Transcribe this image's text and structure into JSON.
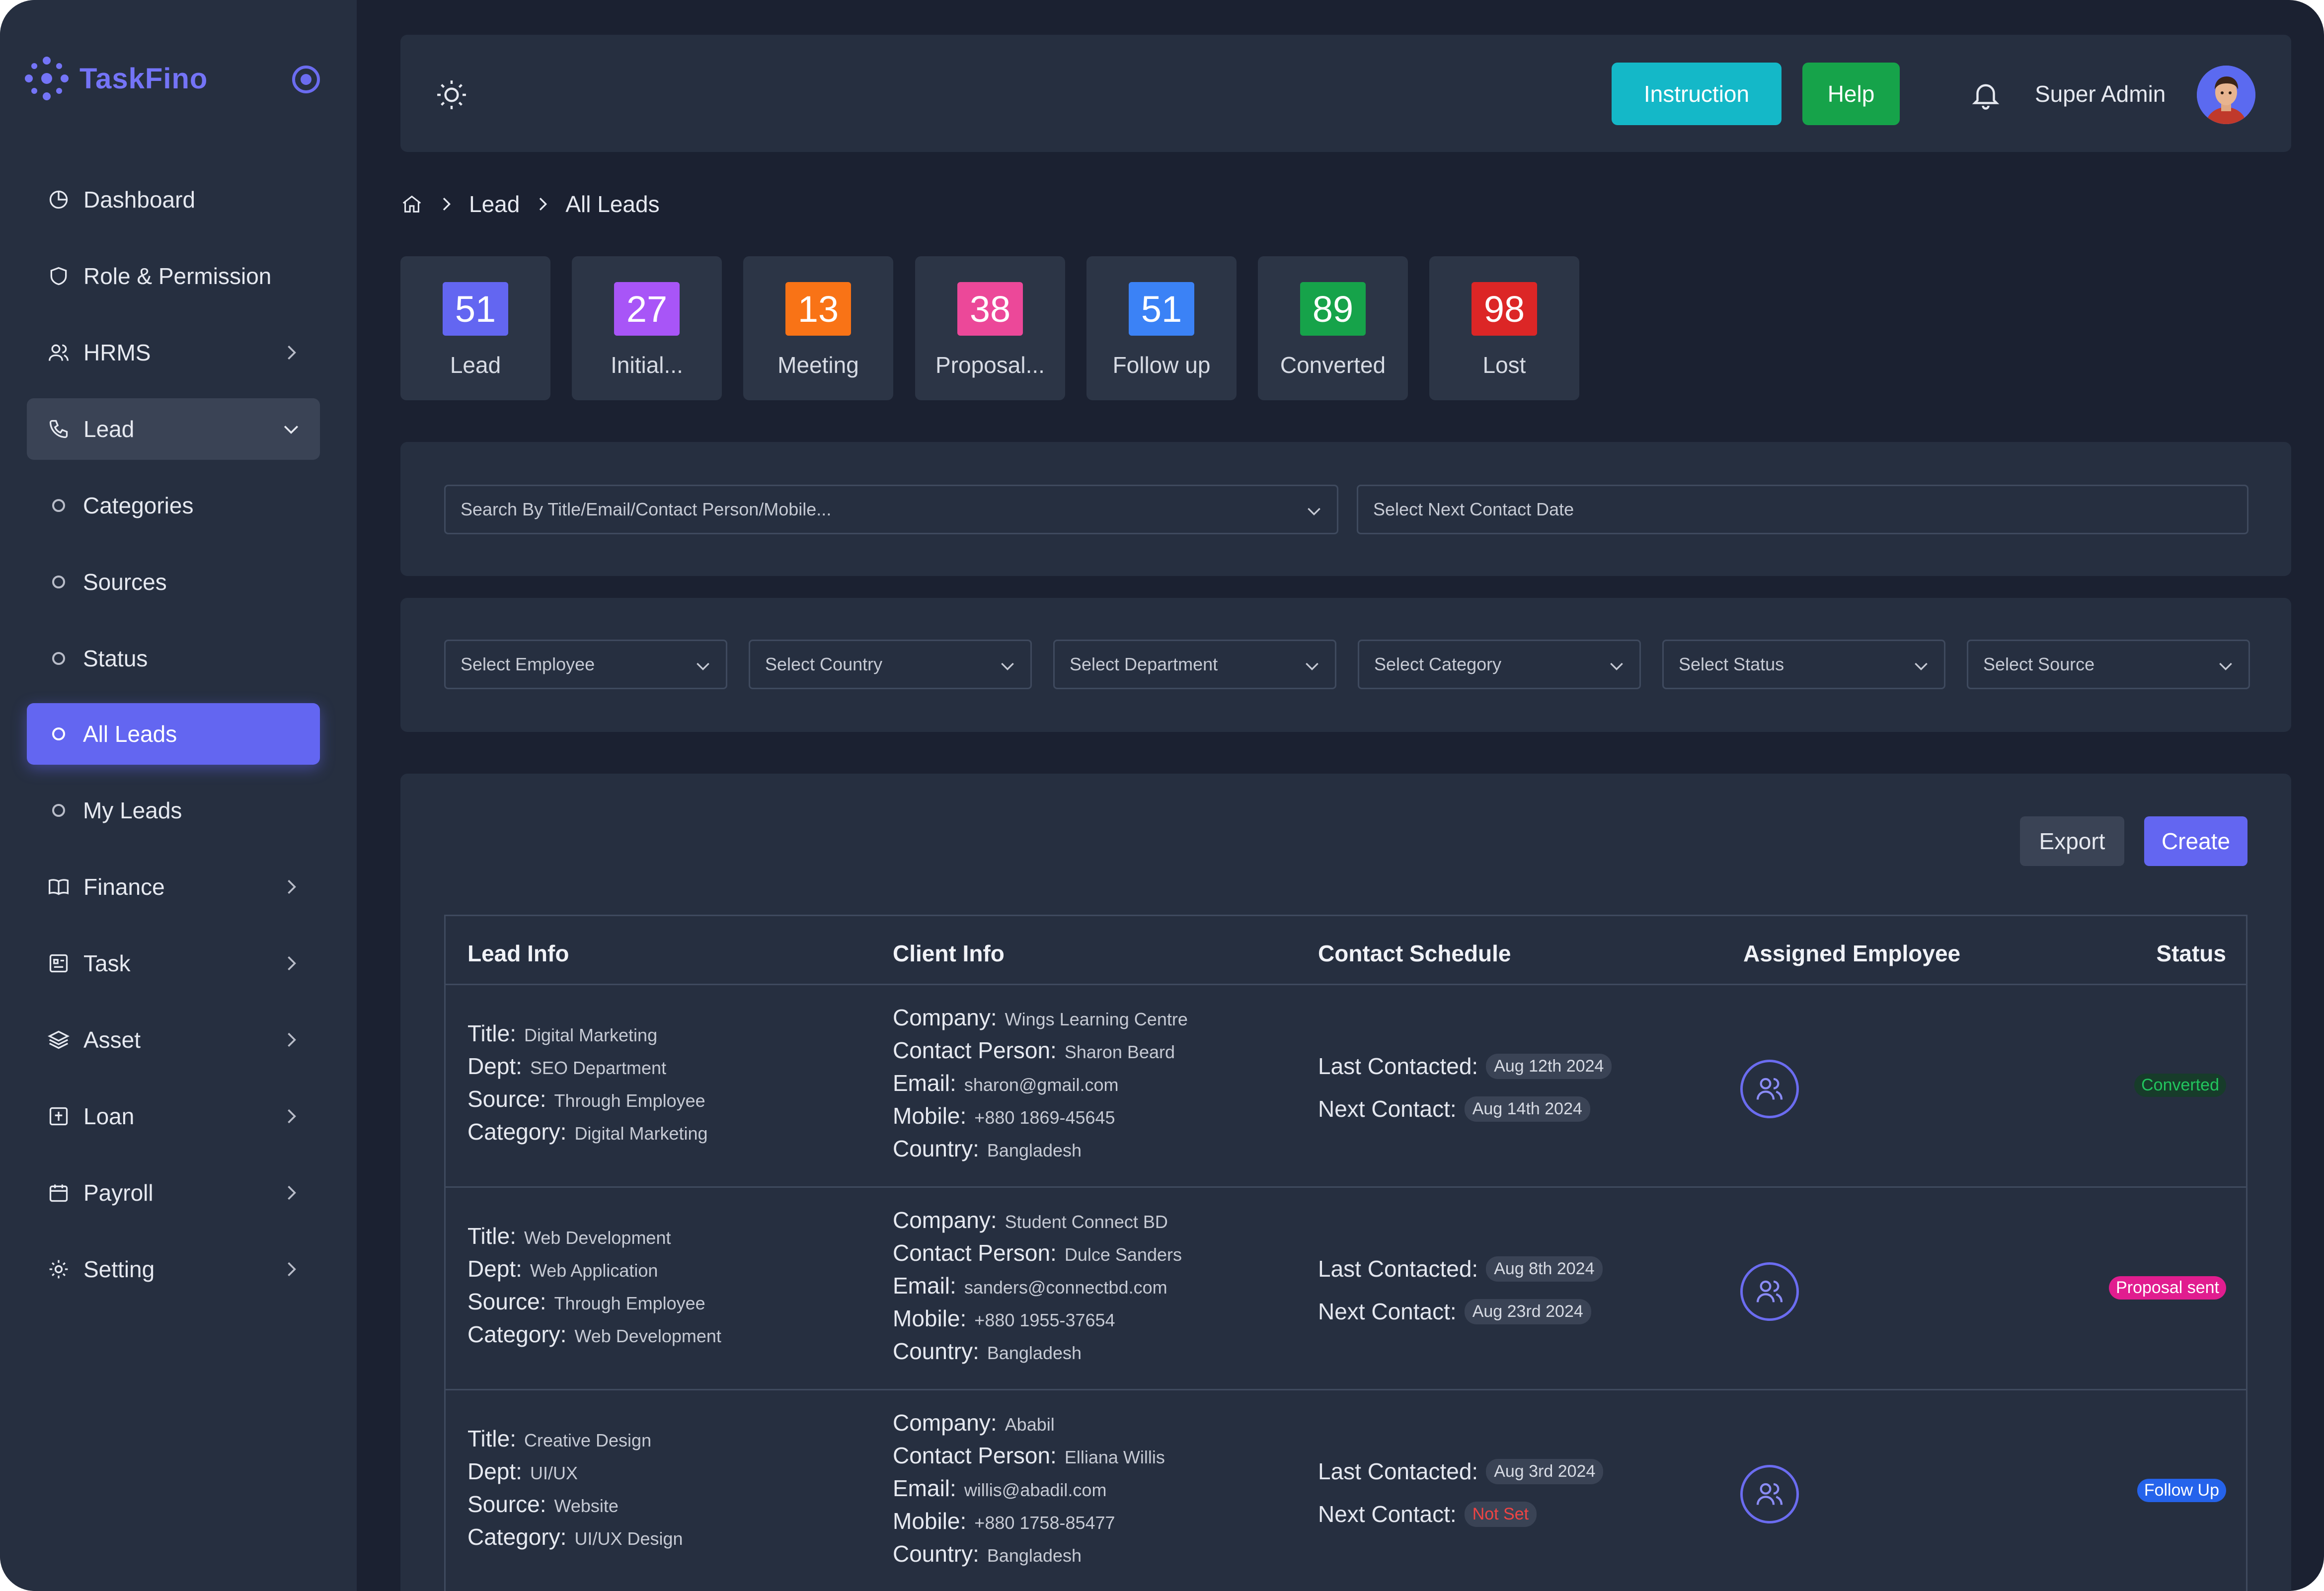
{
  "app": {
    "name": "TaskFino"
  },
  "sidebar": {
    "items": [
      {
        "label": "Dashboard",
        "icon": "dashboard-icon"
      },
      {
        "label": "Role & Permission",
        "icon": "shield-icon"
      },
      {
        "label": "HRMS",
        "icon": "users-icon"
      },
      {
        "label": "Lead",
        "icon": "phone-icon"
      },
      {
        "label": "Categories",
        "icon": "circle-icon"
      },
      {
        "label": "Sources",
        "icon": "circle-icon"
      },
      {
        "label": "Status",
        "icon": "circle-icon"
      },
      {
        "label": "All Leads",
        "icon": "circle-icon"
      },
      {
        "label": "My Leads",
        "icon": "circle-icon"
      },
      {
        "label": "Finance",
        "icon": "book-icon"
      },
      {
        "label": "Task",
        "icon": "task-icon"
      },
      {
        "label": "Asset",
        "icon": "layers-icon"
      },
      {
        "label": "Loan",
        "icon": "loan-icon"
      },
      {
        "label": "Payroll",
        "icon": "calendar-icon"
      },
      {
        "label": "Setting",
        "icon": "gear-icon"
      }
    ]
  },
  "header": {
    "instruction_label": "Instruction",
    "help_label": "Help",
    "user_name": "Super Admin"
  },
  "breadcrumb": {
    "items": [
      "Lead",
      "All Leads"
    ]
  },
  "stats": [
    {
      "value": "51",
      "label": "Lead",
      "color": "#6366f1"
    },
    {
      "value": "27",
      "label": "Initial...",
      "color": "#a855f7"
    },
    {
      "value": "13",
      "label": "Meeting",
      "color": "#f97316"
    },
    {
      "value": "38",
      "label": "Proposal...",
      "color": "#ec4899"
    },
    {
      "value": "51",
      "label": "Follow up",
      "color": "#3b82f6"
    },
    {
      "value": "89",
      "label": "Converted",
      "color": "#16a34a"
    },
    {
      "value": "98",
      "label": "Lost",
      "color": "#dc2626"
    }
  ],
  "filters": {
    "search_placeholder": "Search By Title/Email/Contact Person/Mobile...",
    "date_placeholder": "Select Next Contact Date",
    "employee": "Select Employee",
    "country": "Select Country",
    "department": "Select Department",
    "category": "Select Category",
    "status": "Select Status",
    "source": "Select Source"
  },
  "actions": {
    "export_label": "Export",
    "create_label": "Create"
  },
  "table": {
    "headers": [
      "Lead Info",
      "Client Info",
      "Contact Schedule",
      "Assigned Employee",
      "Status"
    ],
    "labels": {
      "title": "Title:",
      "dept": "Dept:",
      "source": "Source:",
      "category": "Category:",
      "company": "Company:",
      "contact_person": "Contact Person:",
      "email": "Email:",
      "mobile": "Mobile:",
      "country": "Country:",
      "last_contacted": "Last Contacted:",
      "next_contact": "Next Contact:"
    },
    "rows": [
      {
        "title": "Digital Marketing",
        "dept": "SEO Department",
        "source": "Through Employee",
        "category": "Digital Marketing",
        "company": "Wings Learning Centre",
        "contact_person": "Sharon Beard",
        "email": "sharon@gmail.com",
        "mobile": "+880 1869-45645",
        "country": "Bangladesh",
        "last_contacted": "Aug 12th 2024",
        "next_contact": "Aug 14th 2024",
        "status": "Converted"
      },
      {
        "title": "Web Development",
        "dept": "Web Application",
        "source": "Through Employee",
        "category": "Web Development",
        "company": "Student Connect BD",
        "contact_person": "Dulce Sanders",
        "email": "sanders@connectbd.com",
        "mobile": "+880 1955-37654",
        "country": "Bangladesh",
        "last_contacted": "Aug 8th 2024",
        "next_contact": "Aug 23rd 2024",
        "status": "Proposal sent"
      },
      {
        "title": "Creative Design",
        "dept": "UI/UX",
        "source": "Website",
        "category": "UI/UX Design",
        "company": "Ababil",
        "contact_person": "Elliana Willis",
        "email": "willis@abadil.com",
        "mobile": "+880 1758-85477",
        "country": "Bangladesh",
        "last_contacted": "Aug 3rd 2024",
        "next_contact": "Not Set",
        "status": "Follow Up"
      }
    ]
  }
}
